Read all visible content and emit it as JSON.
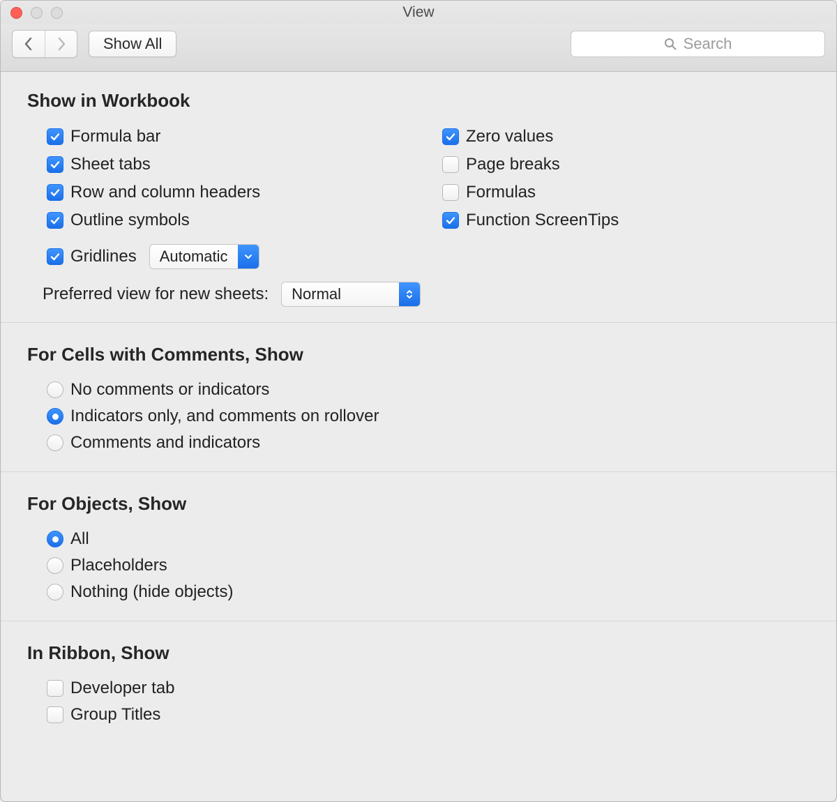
{
  "window": {
    "title": "View"
  },
  "toolbar": {
    "show_all_label": "Show All",
    "search_placeholder": "Search"
  },
  "sections": {
    "show_in_workbook": {
      "heading": "Show in Workbook",
      "left": {
        "formula_bar": "Formula bar",
        "sheet_tabs": "Sheet tabs",
        "row_col_headers": "Row and column headers",
        "outline_symbols": "Outline symbols",
        "gridlines": "Gridlines"
      },
      "right": {
        "zero_values": "Zero values",
        "page_breaks": "Page breaks",
        "formulas": "Formulas",
        "function_screentips": "Function ScreenTips"
      },
      "gridlines_select": "Automatic",
      "preferred_view_label": "Preferred view for new sheets:",
      "preferred_view_value": "Normal"
    },
    "comments": {
      "heading": "For Cells with Comments, Show",
      "opt_none": "No comments or indicators",
      "opt_indicators": "Indicators only, and comments on rollover",
      "opt_both": "Comments and indicators"
    },
    "objects": {
      "heading": "For Objects, Show",
      "opt_all": "All",
      "opt_placeholders": "Placeholders",
      "opt_nothing": "Nothing (hide objects)"
    },
    "ribbon": {
      "heading": "In Ribbon, Show",
      "developer_tab": "Developer tab",
      "group_titles": "Group Titles"
    }
  }
}
